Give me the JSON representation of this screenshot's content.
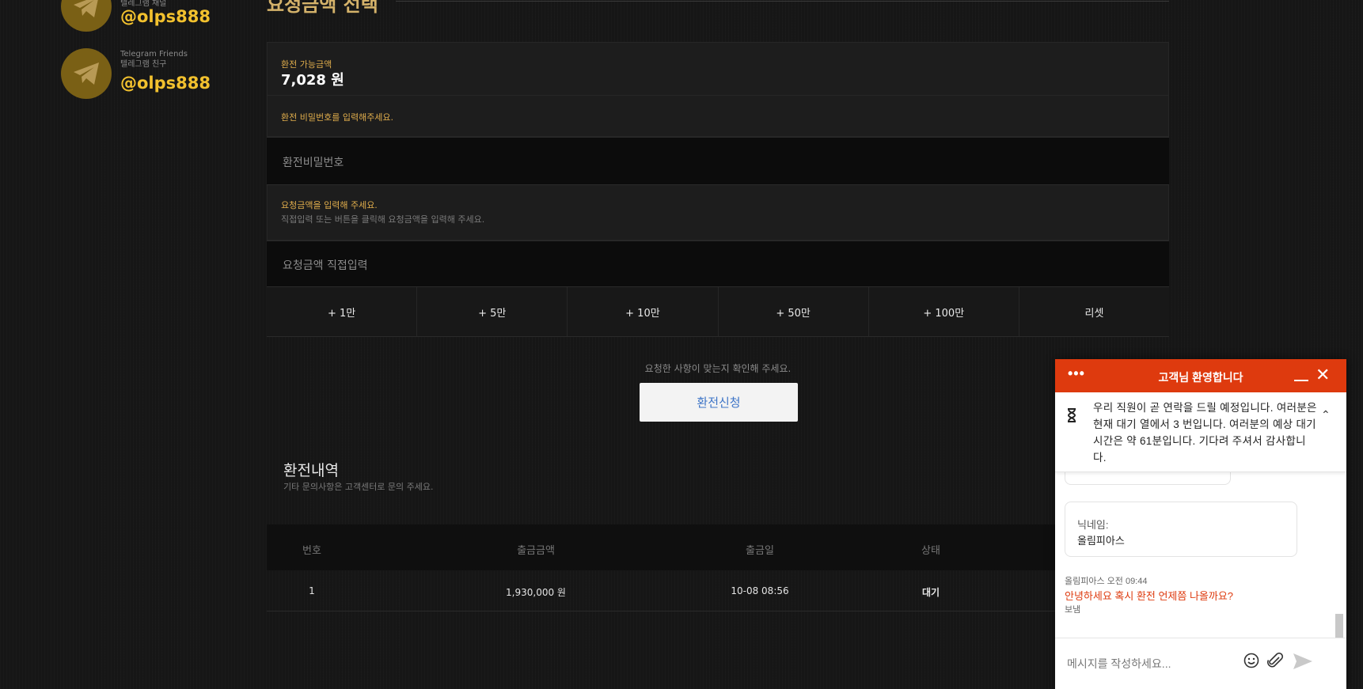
{
  "telegram": [
    {
      "label_en": "",
      "label_kr": "텔레그램 채널",
      "handle": "@olps888"
    },
    {
      "label_en": "Telegram Friends",
      "label_kr": "텔레그램 친구",
      "handle": "@olps888"
    }
  ],
  "section_title": "요청금액 선택",
  "available": {
    "label": "환전 가능금액",
    "amount": "7,028 원"
  },
  "password": {
    "prompt": "환전 비밀번호를 입력해주세요.",
    "placeholder": "환전비밀번호"
  },
  "amount": {
    "prompt": "요청금액을 입력해 주세요.",
    "sub": "직접입력 또는 버튼을 클릭해 요청금액을 입력해 주세요.",
    "placeholder": "요청금액 직접입력"
  },
  "quick_buttons": [
    "+ 1만",
    "+ 5만",
    "+ 10만",
    "+ 50만",
    "+ 100만",
    "리셋"
  ],
  "confirm_text": "요청한 사항이 맞는지 확인해 주세요.",
  "submit_label": "환전신청",
  "history": {
    "title": "환전내역",
    "subtitle": "기타 문의사항은 고객센터로 문의 주세요.",
    "columns": [
      "번호",
      "출금금액",
      "출금일",
      "상태"
    ],
    "rows": [
      [
        "1",
        "1,930,000 원",
        "10-08 08:56",
        "대기"
      ]
    ]
  },
  "chat": {
    "title": "고객님 환영합니다",
    "menu_icon": "•••",
    "close_icon": "✕",
    "notice": "우리 직원이 곧 연락을 드릴 예정입니다. 여러분은 현재 대기 열에서 3 번입니다. 여러분의 예상 대기 시간은 약 61분입니다. 기다려 주셔서 감사합니다.",
    "field_key": "닉네임:",
    "field_value": "올림피아스",
    "msg_meta": "올림피아스 오전 09:44",
    "msg_text": "안녕하세요 혹시 환전 언제쯤 나올까요?",
    "msg_status": "보냄",
    "input_placeholder": "메시지를 작성하세요..."
  },
  "colors": {
    "gold": "#f2c12e",
    "chat_header": "#de3a0e",
    "link_blue": "#3d74c7"
  }
}
